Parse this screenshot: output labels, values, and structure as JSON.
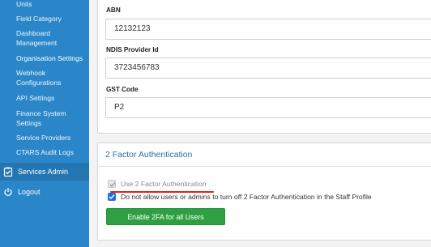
{
  "sidebar": {
    "items": [
      {
        "label": "Units"
      },
      {
        "label": "Field Category"
      },
      {
        "label": "Dashboard Management"
      },
      {
        "label": "Organisation Settings"
      },
      {
        "label": "Webhook Configurations"
      },
      {
        "label": "API Settings"
      },
      {
        "label": "Finance System Settings"
      },
      {
        "label": "Service Providers"
      },
      {
        "label": "CTARS Audit Logs"
      }
    ],
    "services_admin": "Services Admin",
    "logout": "Logout",
    "color": "#2a86c8"
  },
  "organisation": {
    "abn_label": "ABN",
    "abn_value": "12132123",
    "ndis_label": "NDIS Provider Id",
    "ndis_value": "3723456783",
    "gst_label": "GST Code",
    "gst_value": "P2"
  },
  "two_factor": {
    "title": "2 Factor Authentication",
    "use_2fa_label": "Use 2 Factor Authentication",
    "use_2fa_checked": true,
    "use_2fa_disabled": true,
    "no_turn_off_label": "Do not allow users or admins to turn off 2 Factor Authentication in the Staff Profile",
    "no_turn_off_checked": true,
    "enable_button": "Enable 2FA for all Users",
    "button_color": "#2ea043",
    "underline_color": "#d9251d"
  }
}
